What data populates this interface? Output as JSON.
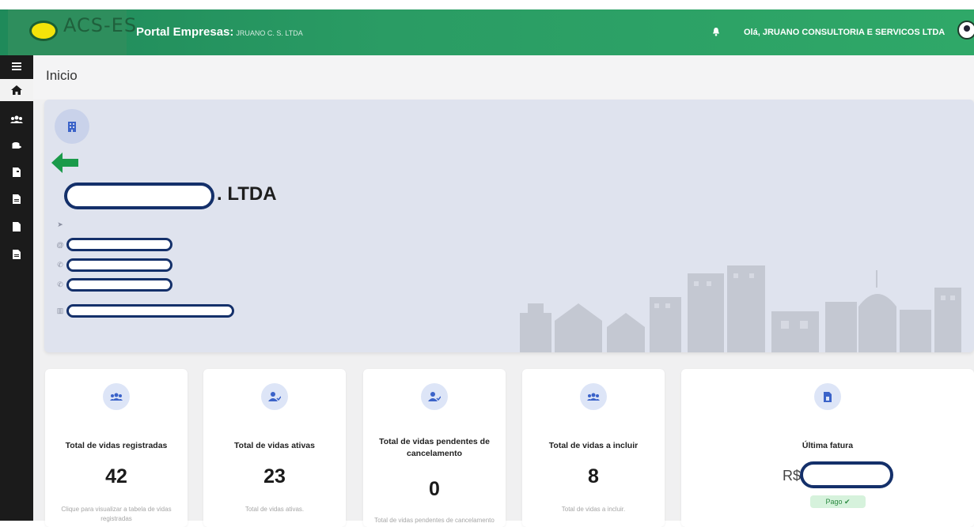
{
  "topbar": {
    "logo_text": "ACS-ES",
    "portal_title": "Portal Empresas:",
    "portal_company": "JRUANO C. S. LTDA",
    "greeting": "Olá, JRUANO CONSULTORIA E SERVICOS LTDA",
    "brand_color": "#2a9c64"
  },
  "sidebar": {
    "items": [
      {
        "icon": "menu-icon"
      },
      {
        "icon": "home-icon"
      },
      {
        "icon": "users-icon"
      },
      {
        "icon": "coins-icon"
      },
      {
        "icon": "file-icon"
      },
      {
        "icon": "file-text-icon"
      },
      {
        "icon": "file-icon"
      },
      {
        "icon": "file-text-icon"
      }
    ]
  },
  "page": {
    "title": "Inicio"
  },
  "company": {
    "name_suffix": ". LTDA",
    "location_icon": "location-arrow-icon",
    "email_icon": "at-icon",
    "phone_icon": "phone-icon",
    "address_icon": "building-icon"
  },
  "stats": [
    {
      "title": "Total de vidas registradas",
      "value": "42",
      "sub": "Clique para visualizar a tabela de vidas registradas",
      "icon": "users-icon"
    },
    {
      "title": "Total de vidas ativas",
      "value": "23",
      "sub": "Total de vidas ativas.",
      "icon": "user-check-icon"
    },
    {
      "title": "Total de vidas pendentes de cancelamento",
      "value": "0",
      "sub": "Total de vidas pendentes de cancelamento",
      "icon": "user-check-icon"
    },
    {
      "title": "Total de vidas a incluir",
      "value": "8",
      "sub": "Total de vidas a incluir.",
      "icon": "users-icon"
    }
  ],
  "invoice": {
    "title": "Última fatura",
    "currency": "R$",
    "status": "Pago ✔",
    "icon": "invoice-icon"
  }
}
